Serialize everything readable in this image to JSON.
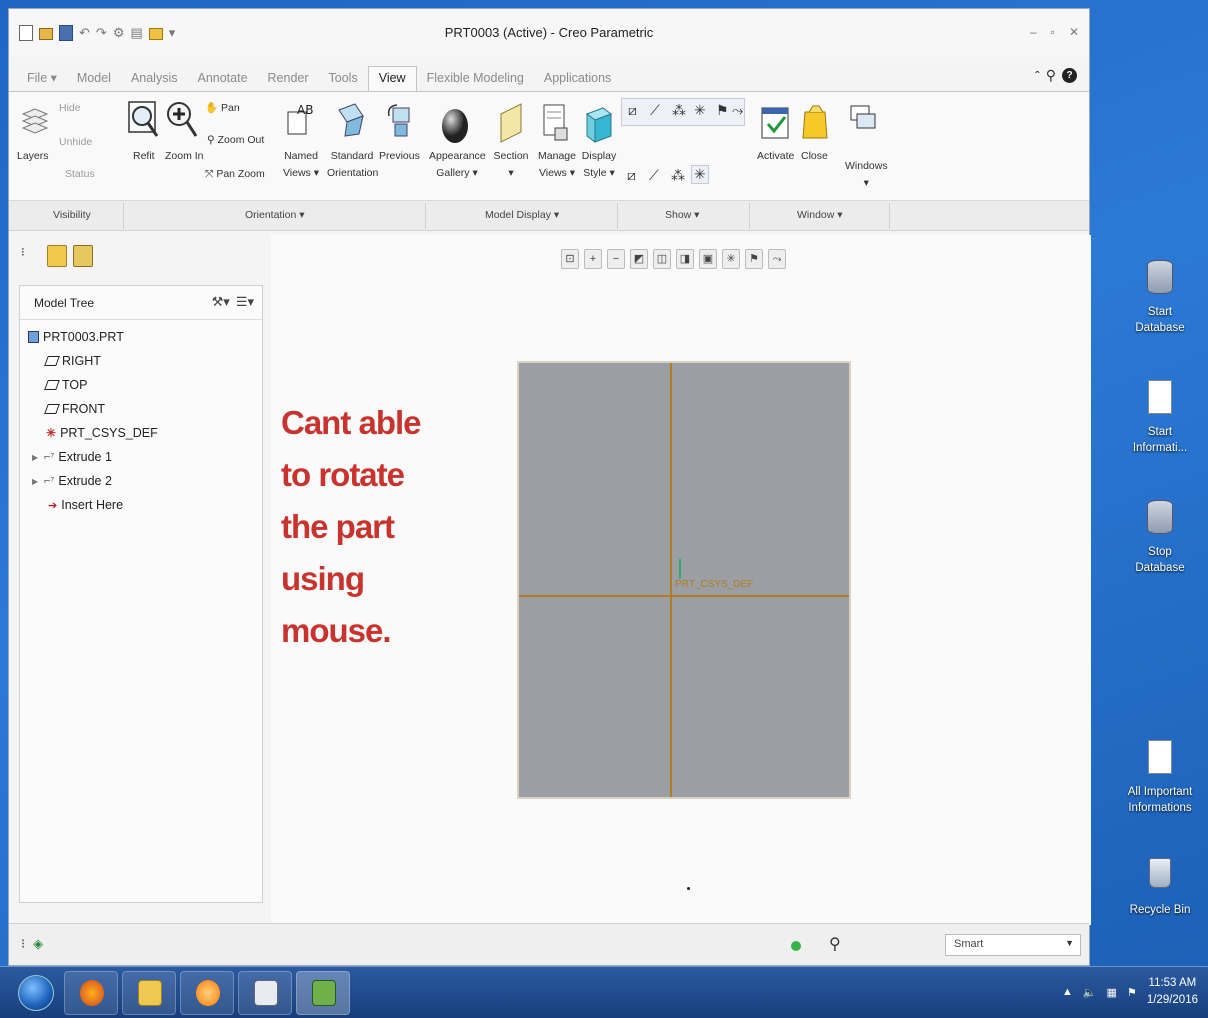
{
  "window": {
    "title": "PRT0003 (Active) - Creo Parametric",
    "controls": [
      "–",
      "▫",
      "✕"
    ]
  },
  "ribbon_tabs": [
    {
      "label": "File ▾",
      "active": false
    },
    {
      "label": "Model",
      "active": false
    },
    {
      "label": "Analysis",
      "active": false
    },
    {
      "label": "Annotate",
      "active": false
    },
    {
      "label": "Render",
      "active": false
    },
    {
      "label": "Tools",
      "active": false
    },
    {
      "label": "View",
      "active": true
    },
    {
      "label": "Flexible Modeling",
      "active": false
    },
    {
      "label": "Applications",
      "active": false
    }
  ],
  "ribbon": {
    "visibility": {
      "layers": "Layers",
      "hide": "Hide",
      "unhide": "Unhide",
      "status": "Status"
    },
    "orientation": {
      "refit": "Refit",
      "zoom_in": "Zoom In",
      "pan": "Pan",
      "zoom_out": "Zoom Out",
      "pan_zoom": "Pan Zoom",
      "named_views_1": "Named",
      "named_views_2": "Views ▾",
      "standard_1": "Standard",
      "standard_2": "Orientation",
      "previous": "Previous"
    },
    "model_display": {
      "appearance_1": "Appearance",
      "appearance_2": "Gallery ▾",
      "section_1": "Section",
      "section_2": "▾",
      "manage_1": "Manage",
      "manage_2": "Views ▾",
      "display_1": "Display",
      "display_2": "Style ▾"
    },
    "window_group": {
      "activate": "Activate",
      "close": "Close",
      "windows": "Windows"
    },
    "group_labels": {
      "visibility": "Visibility",
      "orientation": "Orientation ▾",
      "model_display": "Model Display ▾",
      "show": "Show ▾",
      "window": "Window ▾"
    }
  },
  "model_tree": {
    "title": "Model Tree",
    "items": [
      {
        "label": "PRT0003.PRT"
      },
      {
        "label": "RIGHT"
      },
      {
        "label": "TOP"
      },
      {
        "label": "FRONT"
      },
      {
        "label": "PRT_CSYS_DEF"
      },
      {
        "label": "Extrude 1"
      },
      {
        "label": "Extrude 2"
      },
      {
        "label": "Insert Here"
      }
    ]
  },
  "graphics": {
    "annotation": "Cant able to rotate the part using mouse.",
    "csys_label": "PRT_CSYS_DEF"
  },
  "status_bar": {
    "filter_value": "Smart"
  },
  "desktop_icons": [
    {
      "line1": "Start",
      "line2": "Database"
    },
    {
      "line1": "Start",
      "line2": "Informati..."
    },
    {
      "line1": "Stop",
      "line2": "Database"
    },
    {
      "line1": "All Important",
      "line2": "Informations"
    },
    {
      "line1": "Recycle Bin",
      "line2": ""
    }
  ],
  "taskbar": {
    "time": "11:53 AM",
    "date": "1/29/2016"
  },
  "colors": {
    "annotation": "#c9332e",
    "part_fill": "#9b9ea2",
    "datum": "#b07e20",
    "desktop": "#1e66c2"
  }
}
